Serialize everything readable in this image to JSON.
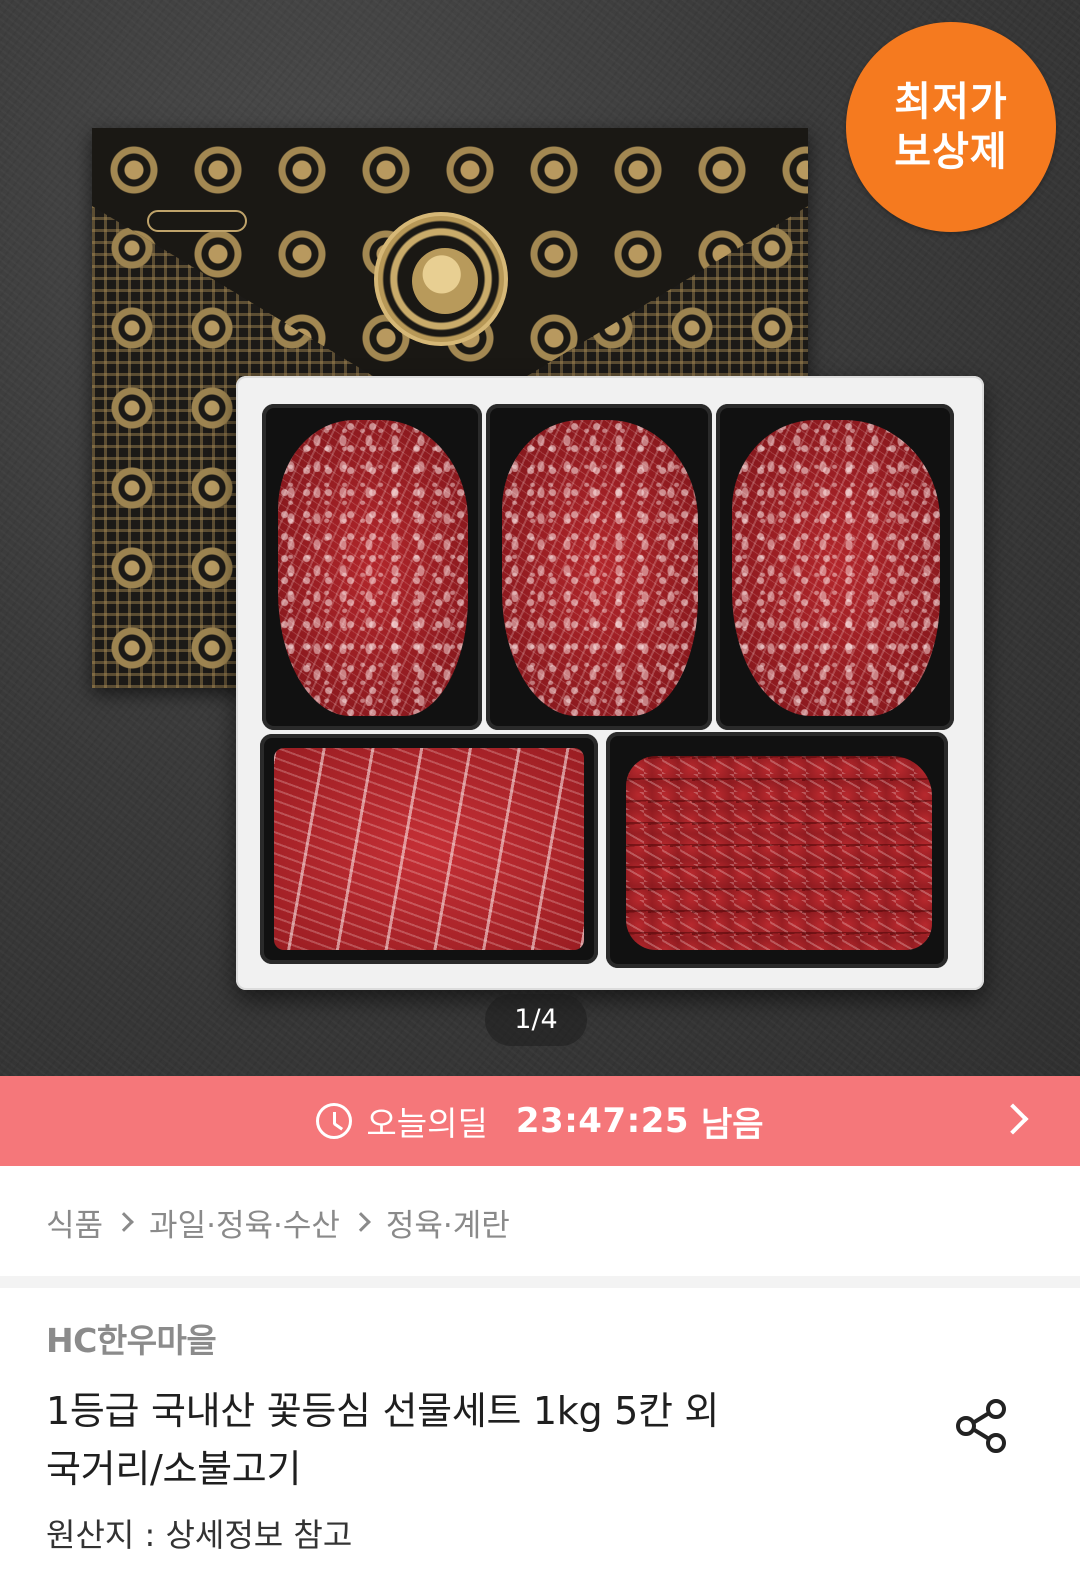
{
  "hero": {
    "badge_line1": "최저가",
    "badge_line2": "보상제",
    "pager": "1/4"
  },
  "deal": {
    "label": "오늘의딜",
    "time": "23:47:25",
    "suffix": "남음",
    "icon": "clock-icon"
  },
  "breadcrumb": [
    "식품",
    "과일·정육·수산",
    "정육·계란"
  ],
  "product": {
    "seller": "HC한우마을",
    "title_line1": "1등급 국내산 꽃등심 선물세트 1kg 5칸 외",
    "title_line2": "국거리/소불고기",
    "origin": "원산지 : 상세정보 참고"
  },
  "colors": {
    "badge": "#f57a1f",
    "deal_banner": "#f5777a"
  }
}
